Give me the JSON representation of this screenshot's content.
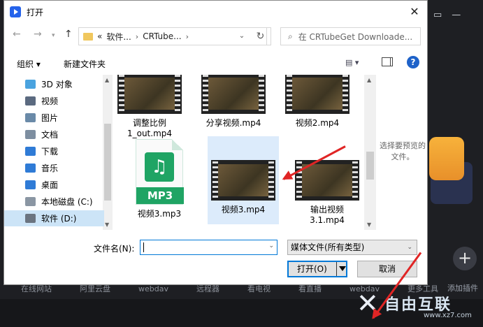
{
  "background": {
    "bottom_tabs": [
      "在线网站",
      "阿里云盘",
      "webdav",
      "远程器",
      "看电视",
      "看直播",
      "webdav",
      "更多工具"
    ],
    "add_plugin_label": "添加插件",
    "watermark": {
      "text": "自由互联",
      "url": "www.xz7.com"
    }
  },
  "dialog": {
    "title": "打开",
    "close_icon": "✕",
    "address": {
      "crumbs": [
        "«",
        "软件...",
        "CRTube..."
      ]
    },
    "search_placeholder": "在 CRTubeGet Downloade...",
    "toolbar": {
      "organize": "组织 ▾",
      "new_folder": "新建文件夹",
      "help": "?"
    },
    "nav_items": [
      {
        "label": "3D 对象",
        "icon": "3d-objects-icon",
        "color": "#4aa3df"
      },
      {
        "label": "视频",
        "icon": "video-folder-icon",
        "color": "#5b6a80"
      },
      {
        "label": "图片",
        "icon": "pictures-folder-icon",
        "color": "#6a8aa8"
      },
      {
        "label": "文档",
        "icon": "documents-folder-icon",
        "color": "#7d8ea0"
      },
      {
        "label": "下载",
        "icon": "download-icon",
        "color": "#2f7bd6"
      },
      {
        "label": "音乐",
        "icon": "music-icon",
        "color": "#2f7bd6"
      },
      {
        "label": "桌面",
        "icon": "desktop-icon",
        "color": "#2f7bd6"
      },
      {
        "label": "本地磁盘 (C:)",
        "icon": "disk-c-icon",
        "color": "#8a96a3"
      },
      {
        "label": "软件 (D:)",
        "icon": "disk-d-icon",
        "color": "#6b7480",
        "selected": true
      }
    ],
    "files": [
      {
        "name": "调整比例\n1_out.mp4",
        "type": "video"
      },
      {
        "name": "分享视频.mp4",
        "type": "video"
      },
      {
        "name": "视频2.mp4",
        "type": "video"
      },
      {
        "name": "视频3.mp3",
        "type": "mp3",
        "badge": "MP3"
      },
      {
        "name": "视频3.mp4",
        "type": "video",
        "selected": true
      },
      {
        "name": "输出视频\n3.1.mp4",
        "type": "video"
      }
    ],
    "preview_text": "选择要预览的文件。",
    "filename_label": "文件名(N):",
    "filename_value": "",
    "filetype_value": "媒体文件(所有类型)",
    "open_button": "打开(O)",
    "cancel_button": "取消"
  }
}
